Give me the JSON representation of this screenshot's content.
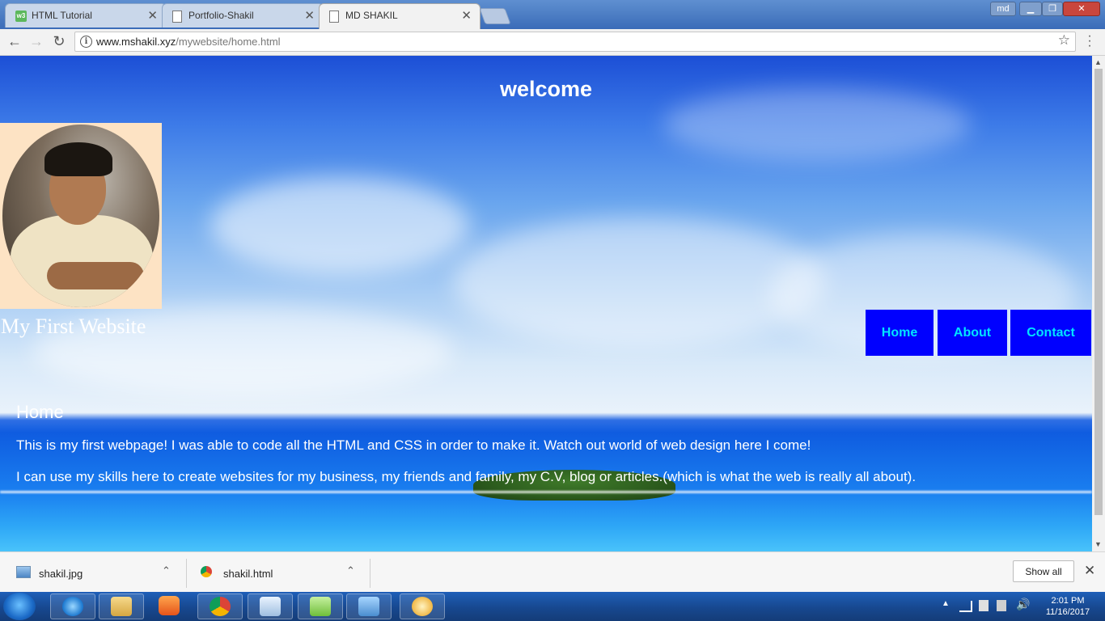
{
  "browser": {
    "tabs": [
      {
        "title": "HTML Tutorial",
        "favicon": "w3schools-icon"
      },
      {
        "title": "Portfolio-Shakil",
        "favicon": "page-icon"
      },
      {
        "title": "MD SHAKIL",
        "favicon": "page-icon",
        "active": true
      }
    ],
    "profile_label": "md",
    "address": {
      "host": "www.mshakil.xyz",
      "path": "/mywebsite/home.html"
    }
  },
  "page": {
    "welcome": "welcome",
    "site_title": "My First Website",
    "nav": [
      "Home",
      "About",
      "Contact"
    ],
    "section_heading": "Home",
    "paragraphs": [
      "This is my first webpage! I was able to code all the HTML and CSS in order to make it. Watch out world of web design here I come!",
      "I can use my skills here to create websites for my business, my friends and family, my C.V, blog or articles.(which is what the web is really all about)."
    ],
    "colors": {
      "nav_bg": "#0000ff",
      "nav_text": "#00e5ff",
      "text": "#ffffff"
    }
  },
  "downloads": {
    "items": [
      {
        "name": "shakil.jpg",
        "icon": "image-file-icon"
      },
      {
        "name": "shakil.html",
        "icon": "chrome-file-icon"
      }
    ],
    "show_all": "Show all"
  },
  "taskbar": {
    "apps": [
      "internet-explorer-icon",
      "file-explorer-icon",
      "media-player-icon",
      "chrome-icon",
      "notepad-icon",
      "notepad-plus-icon",
      "picture-viewer-icon",
      "paint-icon"
    ],
    "time": "2:01 PM",
    "date": "11/16/2017"
  }
}
